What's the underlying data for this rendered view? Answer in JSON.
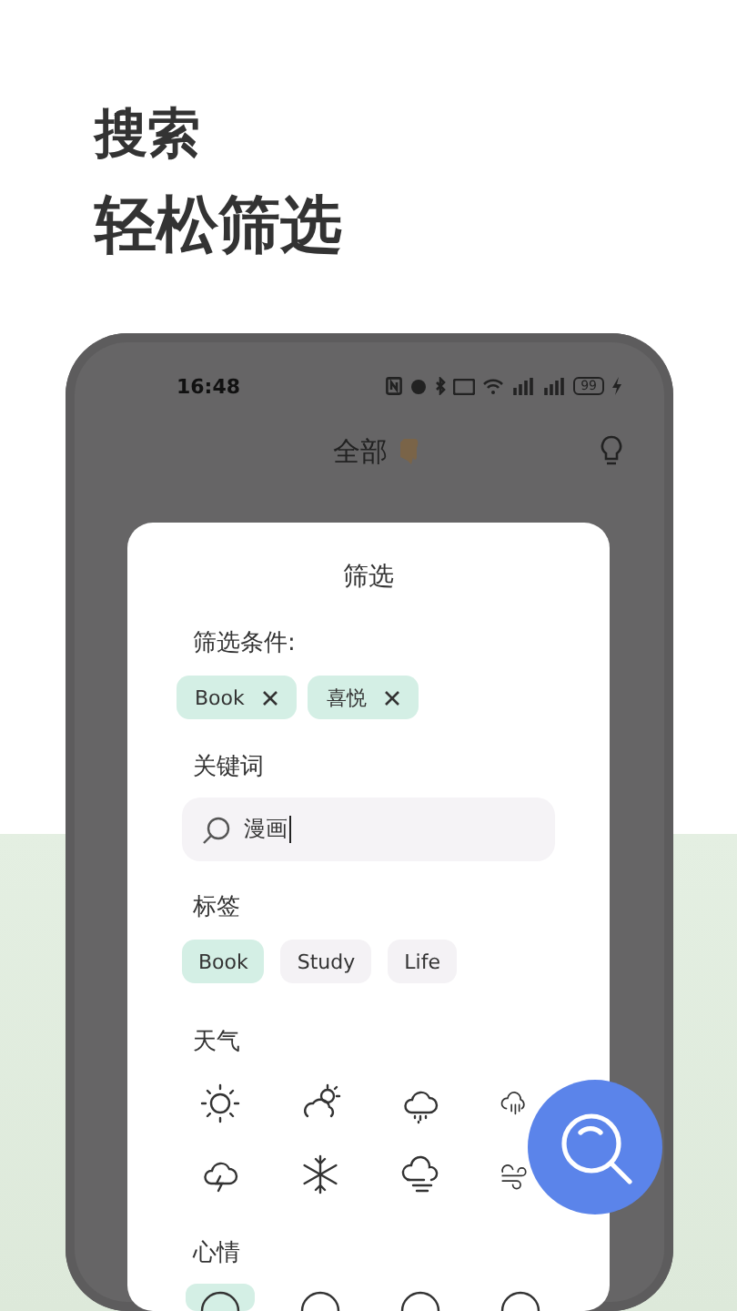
{
  "headline": {
    "line_1": "搜索",
    "line_2": "轻松筛选"
  },
  "status_bar": {
    "time": "16:48",
    "battery": "99"
  },
  "header": {
    "title": "全部"
  },
  "filter_panel": {
    "title": "筛选",
    "conditions_label": "筛选条件:",
    "conditions": [
      "Book",
      "喜悦"
    ],
    "keyword_label": "关键词",
    "keyword": {
      "value": "漫画"
    },
    "tags_label": "标签",
    "tags": [
      {
        "label": "Book",
        "selected": true
      },
      {
        "label": "Study",
        "selected": false
      },
      {
        "label": "Life",
        "selected": false
      }
    ],
    "weather_label": "天气",
    "weather": [
      {
        "kind": "sun",
        "selected": false
      },
      {
        "kind": "partly-cloudy",
        "selected": false
      },
      {
        "kind": "drizzle",
        "selected": false
      },
      {
        "kind": "rain",
        "selected": false
      },
      {
        "kind": "thunder",
        "selected": false
      },
      {
        "kind": "snow",
        "selected": false
      },
      {
        "kind": "fog",
        "selected": false
      },
      {
        "kind": "wind",
        "selected": false
      }
    ],
    "mood_label": "心情",
    "moods": [
      {
        "selected": true
      },
      {
        "selected": false
      },
      {
        "selected": false
      },
      {
        "selected": false
      }
    ]
  }
}
